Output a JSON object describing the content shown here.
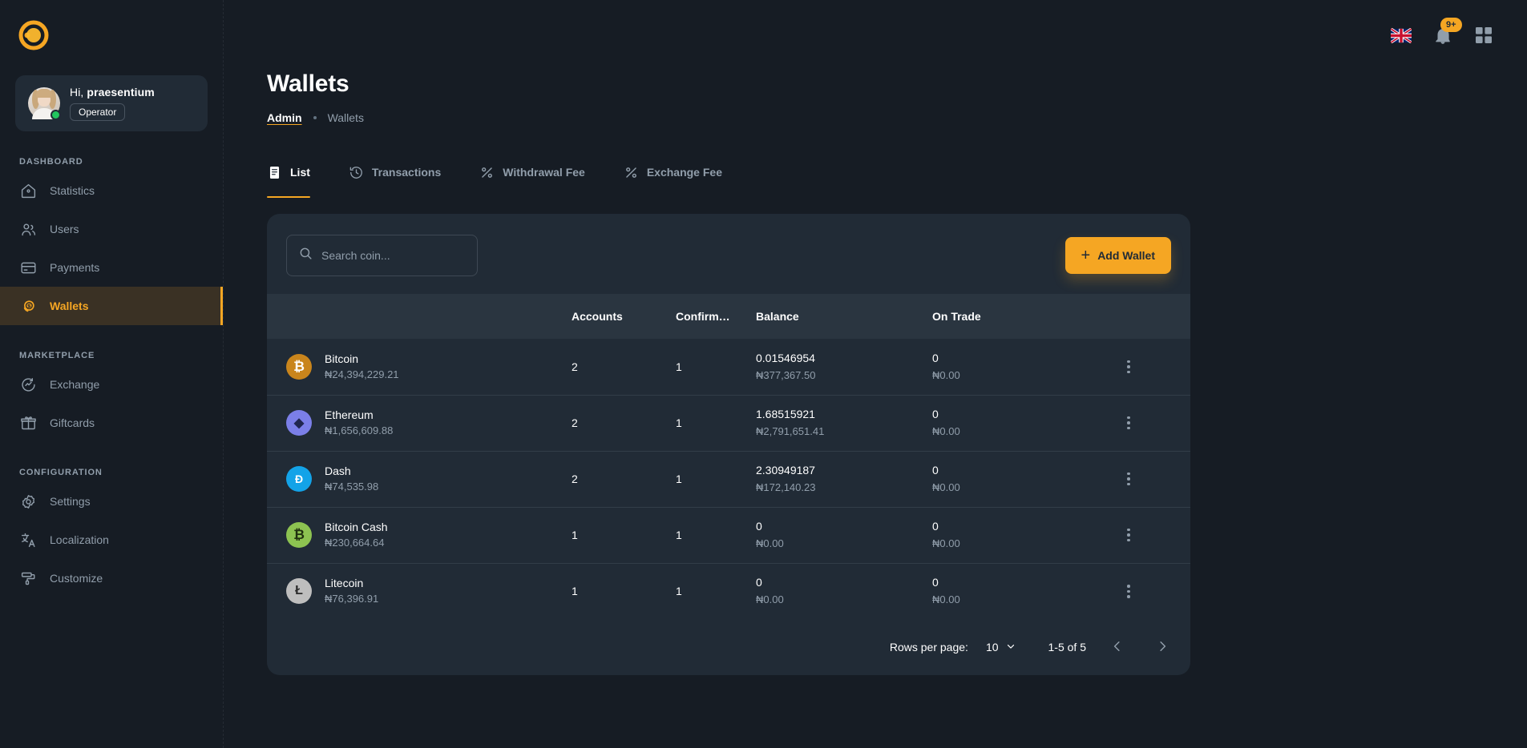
{
  "brand": {
    "logo_icon": "circle-c-logo",
    "accent": "#F5A623"
  },
  "profile": {
    "greeting_prefix": "Hi,",
    "username": "praesentium",
    "role": "Operator",
    "avatar_icon": "avatar",
    "status_icon": "online-dot"
  },
  "sidebar": {
    "sections": [
      {
        "title": "DASHBOARD",
        "items": [
          {
            "label": "Statistics",
            "icon": "home-icon",
            "active": false
          },
          {
            "label": "Users",
            "icon": "users-icon",
            "active": false
          },
          {
            "label": "Payments",
            "icon": "card-icon",
            "active": false
          },
          {
            "label": "Wallets",
            "icon": "coin-icon",
            "active": true
          }
        ]
      },
      {
        "title": "MARKETPLACE",
        "items": [
          {
            "label": "Exchange",
            "icon": "exchange-icon",
            "active": false
          },
          {
            "label": "Giftcards",
            "icon": "gift-icon",
            "active": false
          }
        ]
      },
      {
        "title": "CONFIGURATION",
        "items": [
          {
            "label": "Settings",
            "icon": "gear-icon",
            "active": false
          },
          {
            "label": "Localization",
            "icon": "translate-icon",
            "active": false
          },
          {
            "label": "Customize",
            "icon": "paint-roller-icon",
            "active": false
          }
        ]
      }
    ]
  },
  "topbar": {
    "language_icon": "uk-flag-icon",
    "notifications_icon": "bell-icon",
    "notifications_count": "9+",
    "apps_icon": "grid-apps-icon"
  },
  "header": {
    "title": "Wallets",
    "breadcrumb": {
      "root": "Admin",
      "current": "Wallets"
    }
  },
  "tabs": [
    {
      "label": "List",
      "icon": "list-icon",
      "active": true
    },
    {
      "label": "Transactions",
      "icon": "history-icon",
      "active": false
    },
    {
      "label": "Withdrawal Fee",
      "icon": "percent-icon",
      "active": false
    },
    {
      "label": "Exchange Fee",
      "icon": "percent-icon",
      "active": false
    }
  ],
  "toolbar": {
    "search_placeholder": "Search coin...",
    "search_value": "",
    "search_icon": "search-icon",
    "add_label": "Add Wallet",
    "add_icon": "plus-icon"
  },
  "table": {
    "columns": [
      "",
      "Accounts",
      "Confirm…",
      "Balance",
      "On Trade",
      ""
    ],
    "rows": [
      {
        "coin": "Bitcoin",
        "coin_rate": "₦24,394,229.21",
        "icon": "bitcoin-icon",
        "color": "#C9851C",
        "symbol": "₿",
        "accounts": "2",
        "confirmations": "1",
        "balance": "0.01546954",
        "balance_fiat": "₦377,367.50",
        "on_trade": "0",
        "on_trade_fiat": "₦0.00"
      },
      {
        "coin": "Ethereum",
        "coin_rate": "₦1,656,609.88",
        "icon": "ethereum-icon",
        "color": "#7B7FE8",
        "symbol": "◆",
        "accounts": "2",
        "confirmations": "1",
        "balance": "1.68515921",
        "balance_fiat": "₦2,791,651.41",
        "on_trade": "0",
        "on_trade_fiat": "₦0.00"
      },
      {
        "coin": "Dash",
        "coin_rate": "₦74,535.98",
        "icon": "dash-icon",
        "color": "#13A3E8",
        "symbol": "D",
        "accounts": "2",
        "confirmations": "1",
        "balance": "2.30949187",
        "balance_fiat": "₦172,140.23",
        "on_trade": "0",
        "on_trade_fiat": "₦0.00"
      },
      {
        "coin": "Bitcoin Cash",
        "coin_rate": "₦230,664.64",
        "icon": "bitcoin-cash-icon",
        "color": "#8DC351",
        "symbol": "₿",
        "accounts": "1",
        "confirmations": "1",
        "balance": "0",
        "balance_fiat": "₦0.00",
        "on_trade": "0",
        "on_trade_fiat": "₦0.00"
      },
      {
        "coin": "Litecoin",
        "coin_rate": "₦76,396.91",
        "icon": "litecoin-icon",
        "color": "#BEBEBE",
        "symbol": "Ł",
        "accounts": "1",
        "confirmations": "1",
        "balance": "0",
        "balance_fiat": "₦0.00",
        "on_trade": "0",
        "on_trade_fiat": "₦0.00"
      }
    ]
  },
  "pagination": {
    "rows_per_page_label": "Rows per page:",
    "rows_per_page_value": "10",
    "range_label": "1-5 of 5",
    "prev_icon": "chevron-left-icon",
    "next_icon": "chevron-right-icon"
  }
}
